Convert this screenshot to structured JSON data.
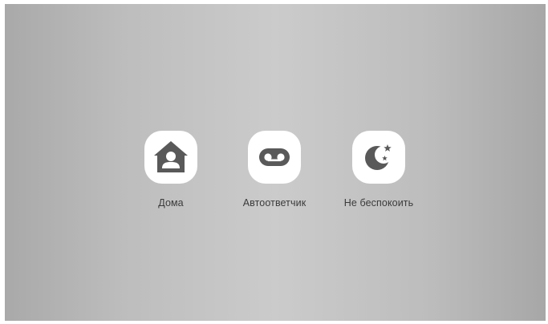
{
  "modes": [
    {
      "label": "Дома",
      "icon": "home-person-icon"
    },
    {
      "label": "Автоответчик",
      "icon": "voicemail-icon"
    },
    {
      "label": "Не беспокоить",
      "icon": "moon-stars-icon"
    }
  ],
  "colors": {
    "background_edge": "#a9a9a9",
    "background_center": "#cbcbcb",
    "tile": "#ffffff",
    "icon": "#595959",
    "label": "#3b3b3b"
  }
}
